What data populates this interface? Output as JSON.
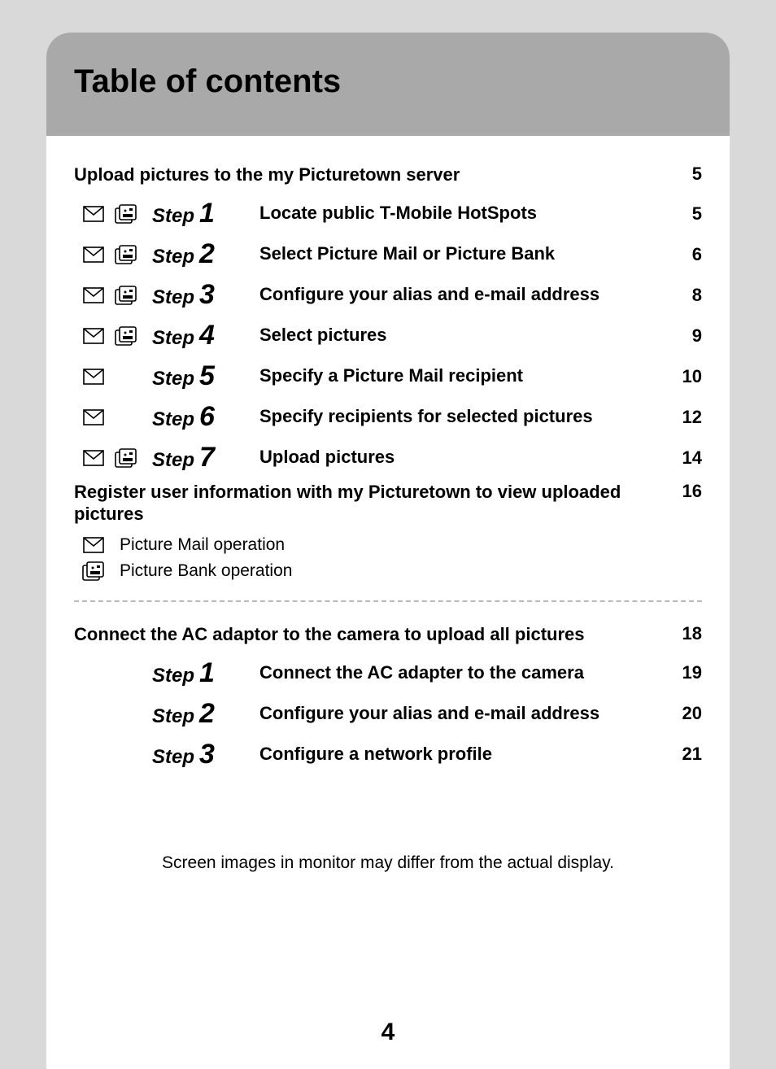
{
  "header": {
    "title": "Table of contents"
  },
  "section1": {
    "heading": "Upload pictures to the my Picturetown server",
    "page": "5",
    "steps": [
      {
        "mail": true,
        "bank": true,
        "label": "Step",
        "num": "1",
        "desc": "Locate public T-Mobile HotSpots",
        "page": "5"
      },
      {
        "mail": true,
        "bank": true,
        "label": "Step",
        "num": "2",
        "desc": "Select Picture Mail or Picture Bank",
        "page": "6"
      },
      {
        "mail": true,
        "bank": true,
        "label": "Step",
        "num": "3",
        "desc": "Configure your alias and e-mail address",
        "page": "8"
      },
      {
        "mail": true,
        "bank": true,
        "label": "Step",
        "num": "4",
        "desc": "Select pictures",
        "page": "9"
      },
      {
        "mail": true,
        "bank": false,
        "label": "Step",
        "num": "5",
        "desc": "Specify a Picture Mail recipient",
        "page": "10"
      },
      {
        "mail": true,
        "bank": false,
        "label": "Step",
        "num": "6",
        "desc": "Specify recipients for selected pictures",
        "page": "12"
      },
      {
        "mail": true,
        "bank": true,
        "label": "Step",
        "num": "7",
        "desc": "Upload pictures",
        "page": "14"
      }
    ],
    "heading2": "Register user information with my Picturetown to view uploaded pictures",
    "page2": "16"
  },
  "legend": {
    "mail": "Picture Mail operation",
    "bank": "Picture Bank operation"
  },
  "section2": {
    "heading": "Connect the AC adaptor to the camera to upload all pictures",
    "page": "18",
    "steps": [
      {
        "label": "Step",
        "num": "1",
        "desc": "Connect the AC adapter to the camera",
        "page": "19"
      },
      {
        "label": "Step",
        "num": "2",
        "desc": "Configure your alias and e-mail address",
        "page": "20"
      },
      {
        "label": "Step",
        "num": "3",
        "desc": "Configure a network profile",
        "page": "21"
      }
    ]
  },
  "note": "Screen images in monitor may differ from the actual display.",
  "pageNumber": "4"
}
